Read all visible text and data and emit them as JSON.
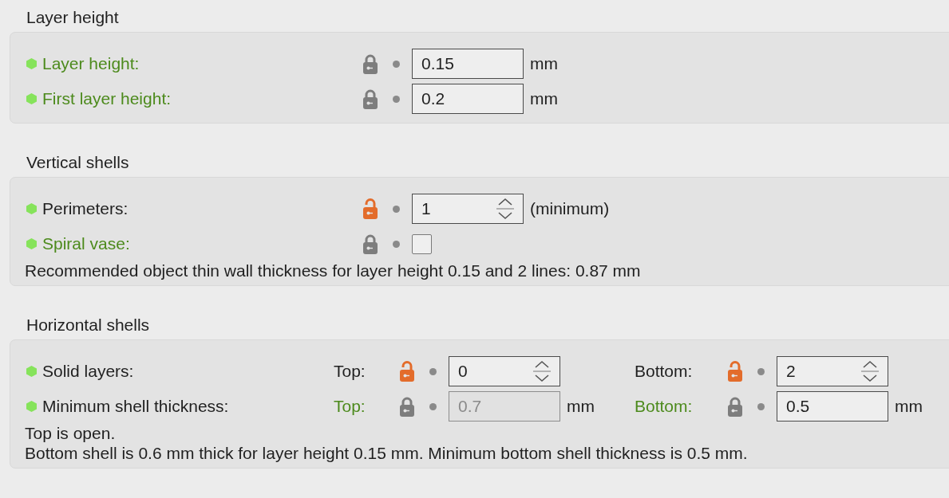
{
  "sections": [
    {
      "title": "Layer height",
      "rows": [
        {
          "label": "Layer height:",
          "modified": true,
          "fields": [
            {
              "kind": "text",
              "locked": true,
              "value": "0.15",
              "disabled": false,
              "side_text": "mm"
            }
          ]
        },
        {
          "label": "First layer height:",
          "modified": true,
          "fields": [
            {
              "kind": "text",
              "locked": true,
              "value": "0.2",
              "disabled": false,
              "side_text": "mm"
            }
          ]
        }
      ]
    },
    {
      "title": "Vertical shells",
      "rows": [
        {
          "label": "Perimeters:",
          "modified": false,
          "fields": [
            {
              "kind": "spin",
              "locked": false,
              "value": "1",
              "disabled": false,
              "side_text": "(minimum)"
            }
          ]
        },
        {
          "label": "Spiral vase:",
          "modified": true,
          "fields": [
            {
              "kind": "checkbox",
              "locked": true,
              "checked": false,
              "disabled": false
            }
          ]
        }
      ],
      "notes": [
        "Recommended object thin wall thickness for layer height 0.15 and 2 lines: 0.87 mm"
      ]
    },
    {
      "title": "Horizontal shells",
      "rows": [
        {
          "label": "Solid layers:",
          "modified": false,
          "fields": [
            {
              "label": "Top:",
              "modified": false,
              "kind": "spin",
              "locked": false,
              "value": "0",
              "disabled": false
            },
            {
              "label": "Bottom:",
              "modified": false,
              "kind": "spin",
              "locked": false,
              "value": "2",
              "disabled": false
            }
          ]
        },
        {
          "label": "Minimum shell thickness:",
          "modified": false,
          "fields": [
            {
              "label": "Top:",
              "modified": true,
              "kind": "text",
              "locked": true,
              "value": "0.7",
              "disabled": true,
              "side_text": "mm"
            },
            {
              "label": "Bottom:",
              "modified": true,
              "kind": "text",
              "locked": true,
              "value": "0.5",
              "disabled": false,
              "side_text": "mm"
            }
          ]
        }
      ],
      "notes": [
        "Top is open.",
        "Bottom shell is 0.6 mm thick for layer height 0.15 mm. Minimum bottom shell thickness is 0.5 mm."
      ]
    }
  ]
}
